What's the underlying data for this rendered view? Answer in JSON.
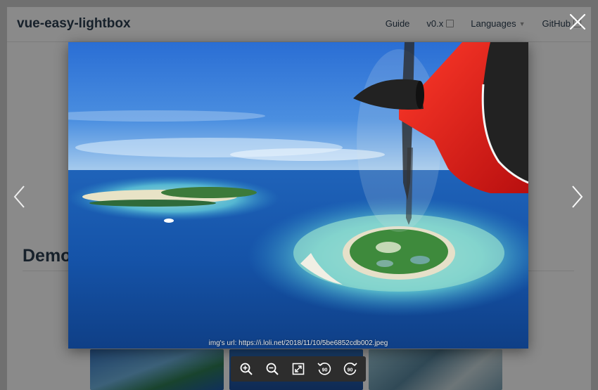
{
  "site": {
    "title": "vue-easy-lightbox",
    "nav": [
      {
        "label": "Guide",
        "icon": null
      },
      {
        "label": "v0.x",
        "icon": "external-link-icon"
      },
      {
        "label": "Languages",
        "icon": "caret-down-icon"
      },
      {
        "label": "GitHub",
        "icon": "external-link-icon"
      }
    ],
    "section_heading": "Demo"
  },
  "lightbox": {
    "caption": "img's url: https://i.loli.net/2018/11/10/5be6852cdb002.jpeg",
    "rotate_left_label": "90",
    "rotate_right_label": "90",
    "toolbar_icons": [
      "zoom-in-icon",
      "zoom-out-icon",
      "fit-screen-icon",
      "rotate-left-icon",
      "rotate-right-icon"
    ],
    "colors": {
      "overlay": "#000000",
      "toolbar": "#2d2d2d",
      "icon": "#ffffff"
    }
  }
}
